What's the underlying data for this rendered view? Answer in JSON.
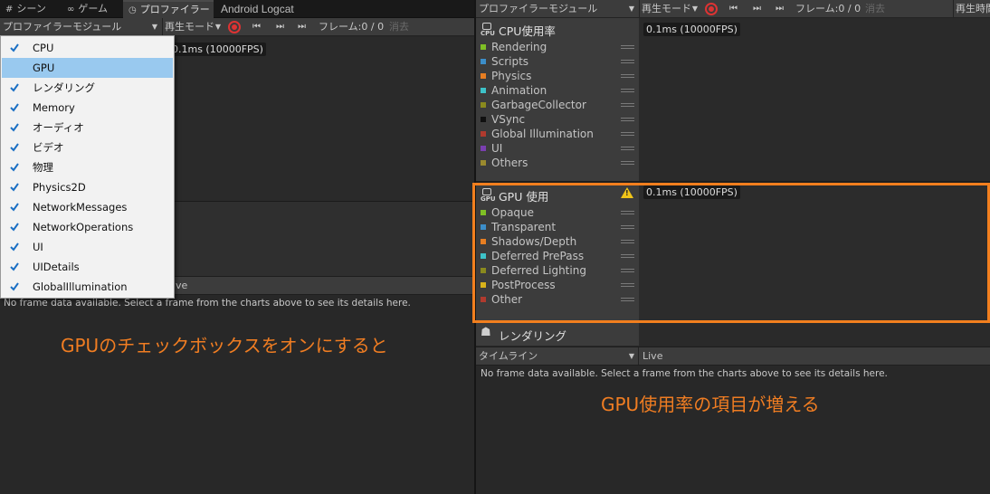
{
  "tabs": [
    {
      "icon": "#",
      "label": "シーン"
    },
    {
      "icon": "∞",
      "label": "ゲーム"
    },
    {
      "icon": "◷",
      "label": "プロファイラー"
    },
    {
      "icon": "",
      "label": "Android Logcat"
    }
  ],
  "toolbar": {
    "modules_label": "プロファイラーモジュール",
    "play_mode": "再生モード",
    "frame_label": "フレーム:0 / 0",
    "clear_label": "消去",
    "play_time_label": "再生時間"
  },
  "fps_value": "0.1ms (10000FPS)",
  "module_menu": [
    {
      "label": "CPU",
      "checked": true,
      "highlighted": false
    },
    {
      "label": "GPU",
      "checked": false,
      "highlighted": true
    },
    {
      "label": "レンダリング",
      "checked": true,
      "highlighted": false
    },
    {
      "label": "Memory",
      "checked": true,
      "highlighted": false
    },
    {
      "label": "オーディオ",
      "checked": true,
      "highlighted": false
    },
    {
      "label": "ビデオ",
      "checked": true,
      "highlighted": false
    },
    {
      "label": "物理",
      "checked": true,
      "highlighted": false
    },
    {
      "label": "Physics2D",
      "checked": true,
      "highlighted": false
    },
    {
      "label": "NetworkMessages",
      "checked": true,
      "highlighted": false
    },
    {
      "label": "NetworkOperations",
      "checked": true,
      "highlighted": false
    },
    {
      "label": "UI",
      "checked": true,
      "highlighted": false
    },
    {
      "label": "UIDetails",
      "checked": true,
      "highlighted": false
    },
    {
      "label": "GlobalIllumination",
      "checked": true,
      "highlighted": false
    }
  ],
  "left_detail": {
    "partial_label": "ve",
    "no_data_text": "No frame data available. Select a frame from the charts above to see its details here."
  },
  "annotation_left": "GPUのチェックボックスをオンにすると",
  "cpu_module": {
    "title": "CPU使用率",
    "legend": [
      {
        "name": "Rendering",
        "color": "#7fbf25"
      },
      {
        "name": "Scripts",
        "color": "#3c8ec9"
      },
      {
        "name": "Physics",
        "color": "#e67e22"
      },
      {
        "name": "Animation",
        "color": "#3dc2c8"
      },
      {
        "name": "GarbageCollector",
        "color": "#8a8a1e"
      },
      {
        "name": "VSync",
        "color": "#101010"
      },
      {
        "name": "Global Illumination",
        "color": "#b03a2e"
      },
      {
        "name": "UI",
        "color": "#7a3fb0"
      },
      {
        "name": "Others",
        "color": "#9a8a2e"
      }
    ]
  },
  "gpu_module": {
    "title": "GPU 使用",
    "legend": [
      {
        "name": "Opaque",
        "color": "#7fbf25"
      },
      {
        "name": "Transparent",
        "color": "#3c8ec9"
      },
      {
        "name": "Shadows/Depth",
        "color": "#e67e22"
      },
      {
        "name": "Deferred PrePass",
        "color": "#3dc2c8"
      },
      {
        "name": "Deferred Lighting",
        "color": "#8a8a1e"
      },
      {
        "name": "PostProcess",
        "color": "#d8b21a"
      },
      {
        "name": "Other",
        "color": "#b03a2e"
      }
    ]
  },
  "rendering_module": {
    "title": "レンダリング"
  },
  "bottom_bar": {
    "view_label": "タイムライン",
    "live_label": "Live",
    "no_data_text": "No frame data available. Select a frame from the charts above to see its details here."
  },
  "annotation_right": "GPU使用率の項目が増える",
  "colors": {
    "accent": "#f27f1e",
    "record": "#dd3333"
  }
}
